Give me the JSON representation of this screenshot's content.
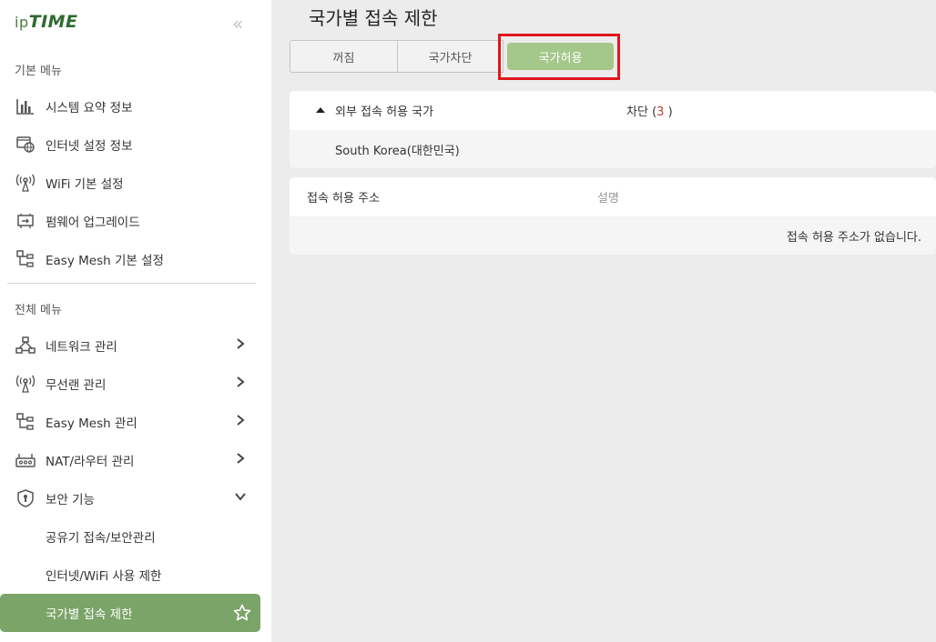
{
  "brand": {
    "ip": "ip",
    "time": "TIME"
  },
  "sidebar": {
    "basic_title": "기본 메뉴",
    "basic_items": [
      {
        "label": "시스템 요약 정보",
        "icon": "chart-bar-icon"
      },
      {
        "label": "인터넷 설정 정보",
        "icon": "globe-monitor-icon"
      },
      {
        "label": "WiFi 기본 설정",
        "icon": "wifi-antenna-icon"
      },
      {
        "label": "펌웨어 업그레이드",
        "icon": "firmware-icon"
      },
      {
        "label": "Easy Mesh 기본 설정",
        "icon": "mesh-icon"
      }
    ],
    "full_title": "전체 메뉴",
    "full_items": [
      {
        "label": "네트워크 관리",
        "icon": "network-icon"
      },
      {
        "label": "무선랜 관리",
        "icon": "wifi-antenna-icon"
      },
      {
        "label": "Easy Mesh 관리",
        "icon": "mesh-icon"
      },
      {
        "label": "NAT/라우터 관리",
        "icon": "router-icon"
      },
      {
        "label": "보안 기능",
        "icon": "shield-icon"
      }
    ],
    "security_sub": [
      {
        "label": "공유기 접속/보안관리"
      },
      {
        "label": "인터넷/WiFi 사용 제한"
      },
      {
        "label": "국가별 접속 제한"
      }
    ]
  },
  "main": {
    "title": "국가별 접속 제한",
    "tabs": [
      "꺼짐",
      "국가차단",
      "국가허용"
    ],
    "active_tab": "국가허용",
    "country_section": {
      "header": "외부 접속 허용 국가",
      "block_label": "차단",
      "block_open": "(",
      "block_count": "3",
      "block_close": ")",
      "country": "South Korea(대한민국)"
    },
    "address_section": {
      "header": "접속 허용 주소",
      "desc_header": "설명",
      "empty": "접속 허용 주소가 없습니다."
    }
  },
  "colors": {
    "accent": "#7aa468",
    "active_tab": "#a4c88a",
    "highlight": "#e0161e",
    "count": "#c0392b"
  }
}
